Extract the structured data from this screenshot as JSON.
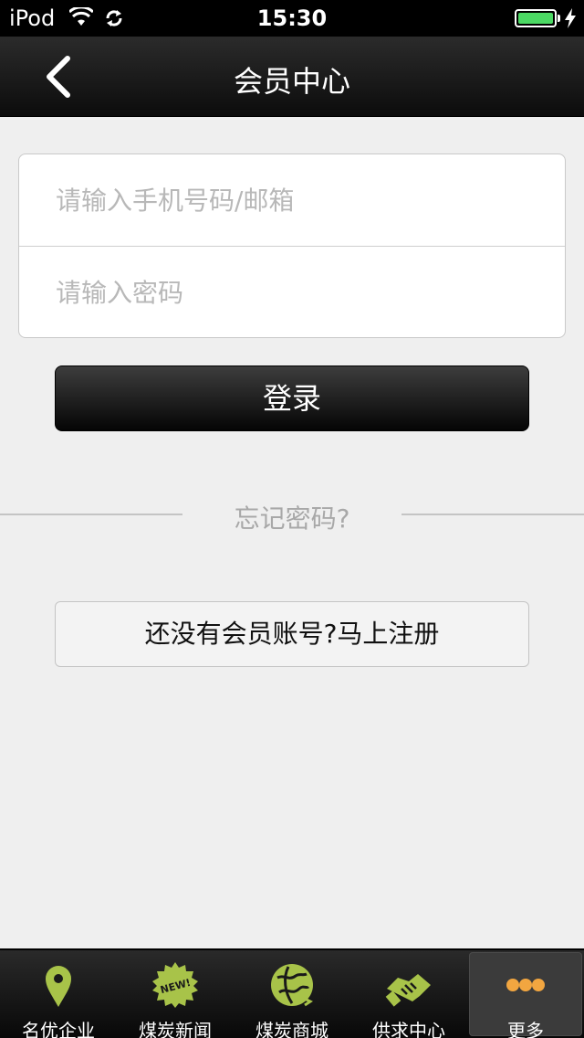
{
  "status_bar": {
    "carrier": "iPod",
    "time": "15:30"
  },
  "nav": {
    "title": "会员中心"
  },
  "login": {
    "phone_placeholder": "请输入手机号码/邮箱",
    "password_placeholder": "请输入密码",
    "login_label": "登录",
    "forgot_label": "忘记密码?",
    "register_label": "还没有会员账号?马上注册"
  },
  "tabs": [
    {
      "label": "名优企业",
      "icon": "location-pin-icon"
    },
    {
      "label": "煤炭新闻",
      "icon": "new-badge-icon"
    },
    {
      "label": "煤炭商城",
      "icon": "globe-icon"
    },
    {
      "label": "供求中心",
      "icon": "handshake-icon"
    },
    {
      "label": "更多",
      "icon": "more-dots-icon"
    }
  ],
  "colors": {
    "accent": "#a8c349",
    "battery": "#4cd964",
    "background": "#efefef"
  }
}
